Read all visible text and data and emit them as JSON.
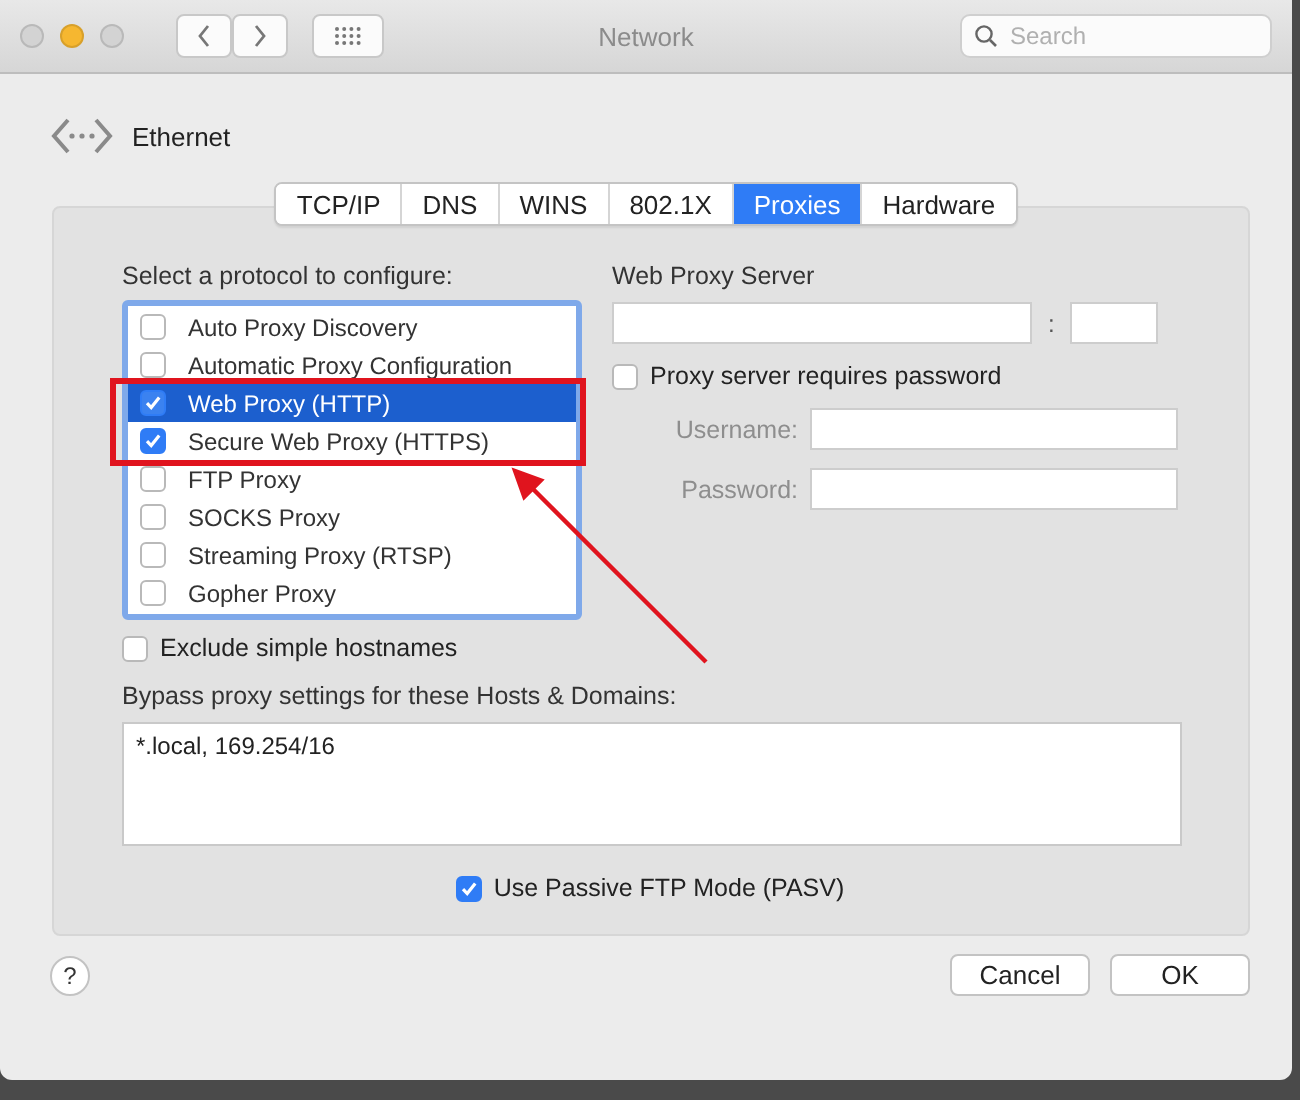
{
  "window": {
    "title": "Network",
    "lights": [
      {
        "color": "#d3d3d3"
      },
      {
        "color": "#f6b730"
      },
      {
        "color": "#d3d3d3"
      }
    ]
  },
  "search": {
    "placeholder": "Search"
  },
  "service": {
    "name": "Ethernet"
  },
  "tabs": [
    {
      "label": "TCP/IP",
      "selected": false
    },
    {
      "label": "DNS",
      "selected": false
    },
    {
      "label": "WINS",
      "selected": false
    },
    {
      "label": "802.1X",
      "selected": false
    },
    {
      "label": "Proxies",
      "selected": true
    },
    {
      "label": "Hardware",
      "selected": false
    }
  ],
  "protocols": {
    "label": "Select a protocol to configure:",
    "items": [
      {
        "label": "Auto Proxy Discovery",
        "checked": false,
        "selected": false
      },
      {
        "label": "Automatic Proxy Configuration",
        "checked": false,
        "selected": false
      },
      {
        "label": "Web Proxy (HTTP)",
        "checked": true,
        "selected": true,
        "highlighted": true
      },
      {
        "label": "Secure Web Proxy (HTTPS)",
        "checked": true,
        "selected": false,
        "highlighted": true
      },
      {
        "label": "FTP Proxy",
        "checked": false,
        "selected": false
      },
      {
        "label": "SOCKS Proxy",
        "checked": false,
        "selected": false
      },
      {
        "label": "Streaming Proxy (RTSP)",
        "checked": false,
        "selected": false
      },
      {
        "label": "Gopher Proxy",
        "checked": false,
        "selected": false
      }
    ]
  },
  "server": {
    "label": "Web Proxy Server",
    "separator": ":",
    "requires_password": {
      "label": "Proxy server requires password",
      "checked": false
    },
    "fields": [
      {
        "label": "Username:",
        "disabled": true
      },
      {
        "label": "Password:",
        "disabled": true
      }
    ]
  },
  "exclude_simple": {
    "label": "Exclude simple hostnames",
    "checked": false
  },
  "bypass": {
    "label": "Bypass proxy settings for these Hosts & Domains:",
    "value": "*.local, 169.254/16"
  },
  "passive_ftp": {
    "label": "Use Passive FTP Mode (PASV)",
    "checked": true
  },
  "help": {
    "label": "?"
  },
  "buttons": [
    "Cancel",
    "OK"
  ],
  "annotation": {
    "kind": "highlight-with-arrow"
  }
}
